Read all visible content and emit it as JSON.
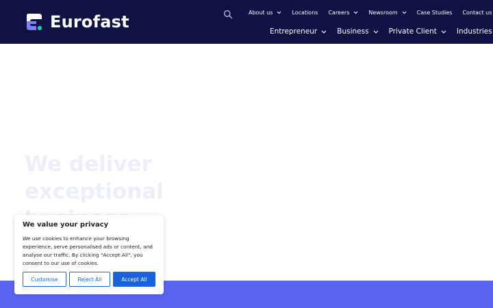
{
  "brand": {
    "name": "Eurofast",
    "colors": {
      "header_bg": "#0f1242",
      "accent_purple": "#5b63f0",
      "accent_teal": "#20c9a6",
      "button_blue": "#1863dc"
    }
  },
  "header": {
    "search_icon": "search-icon",
    "top_nav": [
      {
        "label": "About us",
        "has_dropdown": true
      },
      {
        "label": "Locations",
        "has_dropdown": false
      },
      {
        "label": "Careers",
        "has_dropdown": true
      },
      {
        "label": "Newsroom",
        "has_dropdown": true
      },
      {
        "label": "Case Studies",
        "has_dropdown": false
      },
      {
        "label": "Contact us",
        "has_dropdown": false
      }
    ],
    "main_nav": [
      {
        "label": "Entrepreneur",
        "has_dropdown": true
      },
      {
        "label": "Business",
        "has_dropdown": true
      },
      {
        "label": "Private Client",
        "has_dropdown": true
      },
      {
        "label": "Industries",
        "has_dropdown": true
      }
    ]
  },
  "hero": {
    "headline": "We deliver\nexceptional\nbusiness solutions"
  },
  "cookie_banner": {
    "title": "We value your privacy",
    "body": "We use cookies to enhance your browsing experience, serve personalised ads or content, and analyse our traffic. By clicking \"Accept All\", you consent to our use of cookies.",
    "buttons": {
      "customise": "Customise",
      "reject": "Reject All",
      "accept": "Accept All"
    }
  }
}
